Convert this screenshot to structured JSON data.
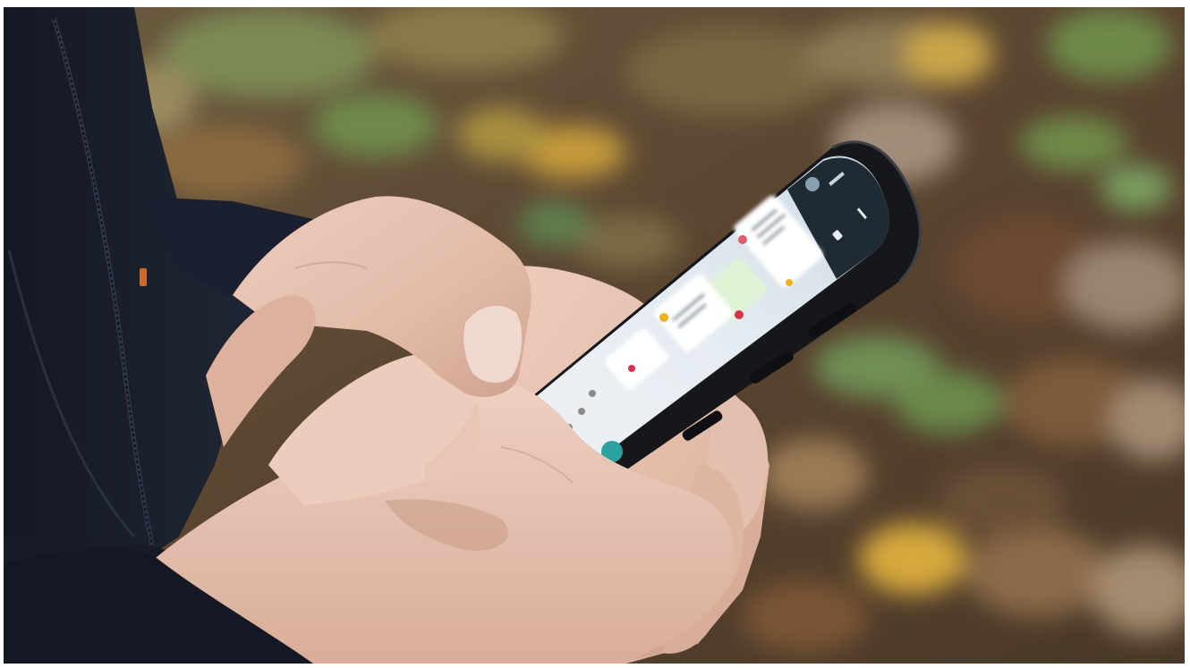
{
  "image": {
    "subject": "hands-typing-on-smartphone",
    "colors": {
      "frame": "#ffffff",
      "background_base": "#5e4a33",
      "leaf_ochre": "#b08a3c",
      "leaf_green": "#6e8a4a",
      "leaf_brown": "#7a5534",
      "jacket": "#1d2230",
      "jacket_shadow": "#10131b",
      "skin": "#e6c2b0",
      "skin_shadow": "#c99a87",
      "phone_body": "#15171b",
      "screen": "#e9eef4",
      "screen_header": "#1f2a33"
    },
    "screen_content": {
      "message_bubbles": 4,
      "emoji_rows": 7
    }
  }
}
